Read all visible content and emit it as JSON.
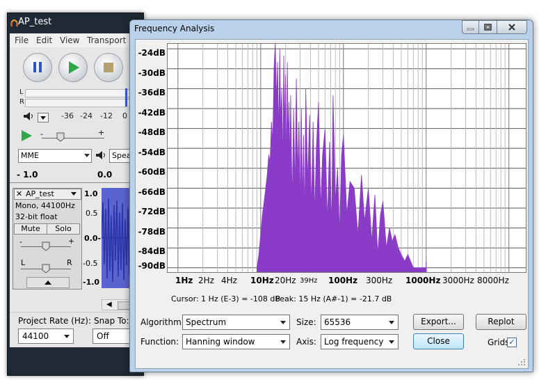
{
  "main_window": {
    "title": "AP_test",
    "menu": [
      "File",
      "Edit",
      "View",
      "Transport"
    ],
    "meter_channels": [
      "L",
      "R"
    ],
    "db_ticks": [
      "-36",
      "-24",
      "-12",
      "0"
    ],
    "device": "MME",
    "speaker": "Spea",
    "ruler_left": "- 1.0",
    "ruler_right": "0.0",
    "track": {
      "name": "AP_test",
      "info_line1": "Mono, 44100Hz",
      "info_line2": "32-bit float",
      "mute": "Mute",
      "solo": "Solo",
      "gain_minus": "-",
      "gain_plus": "+",
      "pan_left": "L",
      "pan_right": "R",
      "scale": [
        "1.0",
        "0.5",
        "0.0-",
        "-0.5",
        "-1.0"
      ]
    },
    "project_rate_label": "Project Rate (Hz):",
    "project_rate_value": "44100",
    "snap_label": "Snap To:",
    "snap_value": "Off"
  },
  "dialog": {
    "title": "Frequency Analysis",
    "y_ticks": [
      "-24dB",
      "-30dB",
      "-36dB",
      "-42dB",
      "-48dB",
      "-54dB",
      "-60dB",
      "-66dB",
      "-72dB",
      "-78dB",
      "-84dB",
      "-90dB"
    ],
    "x_ticks": [
      {
        "label": "1Hz",
        "bold": true
      },
      {
        "label": "2Hz",
        "bold": false
      },
      {
        "label": "4Hz",
        "bold": false
      },
      {
        "label": "10Hz",
        "bold": true
      },
      {
        "label": "20Hz",
        "bold": false
      },
      {
        "label": "39Hz",
        "bold": false,
        "small": true
      },
      {
        "label": "100Hz",
        "bold": true
      },
      {
        "label": "300Hz",
        "bold": false
      },
      {
        "label": "1000Hz",
        "bold": true
      },
      {
        "label": "3000Hz",
        "bold": false
      },
      {
        "label": "8000Hz",
        "bold": false
      }
    ],
    "cursor_text": "Cursor: 1 Hz (E-3) = -108 dB",
    "peak_text": "Peak: 15 Hz (A#-1) = -21.7 dB",
    "algorithm_label": "Algorithm:",
    "algorithm_value": "Spectrum",
    "size_label": "Size:",
    "size_value": "65536",
    "function_label": "Function:",
    "function_value": "Hanning window",
    "axis_label": "Axis:",
    "axis_value": "Log frequency",
    "export_button": "Export...",
    "replot_button": "Replot",
    "close_button": "Close",
    "grids_label": "Grids",
    "grids_checked": "✓"
  },
  "chart_data": {
    "type": "area",
    "x_scale": "log",
    "xlim_hz": [
      1,
      16000
    ],
    "ylim_db": [
      -91,
      -22
    ],
    "grid": true,
    "fill_color": "#8a3bc7",
    "x_hz": [
      9,
      9.5,
      10,
      10.5,
      11,
      11.5,
      12,
      12.5,
      13,
      13.5,
      14,
      14.5,
      15,
      15.5,
      16,
      16.5,
      17,
      17.5,
      18,
      18.5,
      19,
      19.5,
      20,
      20.5,
      21,
      21.5,
      22,
      22.5,
      23,
      24,
      25,
      26,
      27,
      28,
      29,
      30,
      31,
      32,
      33,
      34,
      35,
      37,
      39,
      41,
      43,
      45,
      47,
      50,
      53,
      56,
      60,
      64,
      68,
      72,
      75,
      80,
      85,
      90,
      95,
      100,
      110,
      120,
      135,
      150,
      165,
      180,
      200,
      220,
      240,
      260,
      280,
      300,
      330,
      360,
      390,
      420,
      460,
      500,
      550,
      600,
      700,
      800,
      900,
      1000
    ],
    "y_db": [
      -90,
      -86,
      -80,
      -74,
      -70,
      -66,
      -62,
      -56,
      -58,
      -46,
      -52,
      -30,
      -22,
      -40,
      -28,
      -50,
      -24,
      -46,
      -36,
      -60,
      -26,
      -48,
      -32,
      -60,
      -28,
      -52,
      -40,
      -60,
      -38,
      -70,
      -42,
      -66,
      -33,
      -62,
      -46,
      -72,
      -42,
      -70,
      -50,
      -76,
      -36,
      -64,
      -44,
      -72,
      -46,
      -74,
      -54,
      -40,
      -72,
      -56,
      -48,
      -76,
      -52,
      -78,
      -38,
      -70,
      -60,
      -80,
      -56,
      -50,
      -74,
      -64,
      -66,
      -80,
      -62,
      -76,
      -66,
      -82,
      -68,
      -86,
      -74,
      -70,
      -84,
      -78,
      -82,
      -80,
      -84,
      -86,
      -88,
      -86,
      -90,
      -90,
      -90,
      -90
    ]
  }
}
